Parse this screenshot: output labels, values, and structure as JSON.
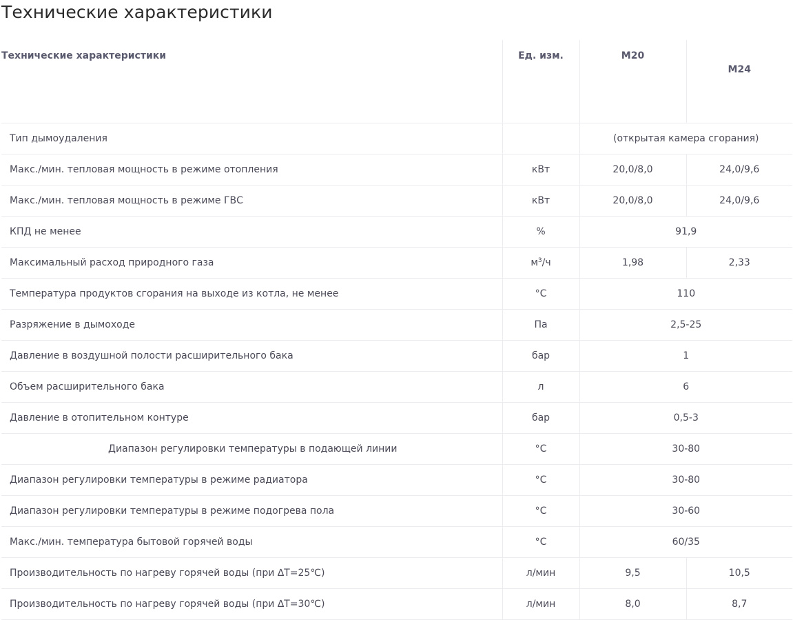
{
  "page": {
    "title": "Технические характеристики"
  },
  "table": {
    "headers": {
      "name": "Технические характеристики",
      "unit": "Ед. изм.",
      "m20": "M20",
      "m24": "M24"
    },
    "rows": [
      {
        "name": "Тип дымоудаления",
        "unit": "",
        "shared": "(открытая камера сгорания)"
      },
      {
        "name": "Макс./мин. тепловая мощность в режиме отопления",
        "unit": "кВт",
        "m20": "20,0/8,0",
        "m24": "24,0/9,6"
      },
      {
        "name": "Макс./мин. тепловая мощность в режиме ГВС",
        "unit": "кВт",
        "m20": "20,0/8,0",
        "m24": "24,0/9,6"
      },
      {
        "name": "КПД не менее",
        "unit": "%",
        "shared": "91,9"
      },
      {
        "name": "Максимальный  расход природного газа",
        "unit_base": "м",
        "unit_sup": "3",
        "unit_tail": "/ч",
        "m20": "1,98",
        "m24": "2,33"
      },
      {
        "name": "Температура продуктов сгорания на выходе из котла, не менее",
        "unit": "°С",
        "shared": "110"
      },
      {
        "name": "Разряжение в дымоходе",
        "unit": "Па",
        "shared": "2,5-25"
      },
      {
        "name": "Давление в воздушной полости расширительного бака",
        "unit": "бар",
        "shared": "1"
      },
      {
        "name": "Объем расширительного бака",
        "unit": "л",
        "shared": "6"
      },
      {
        "name": "Давление в отопительном контуре",
        "unit": "бар",
        "shared": "0,5-3"
      },
      {
        "name": "Диапазон регулировки температуры в подающей линии",
        "unit": "°С",
        "shared": "30-80"
      },
      {
        "name": "Диапазон регулировки температуры в режиме радиатора",
        "unit": "°С",
        "shared": "30-80"
      },
      {
        "name": "Диапазон регулировки температуры в режиме подогрева пола",
        "unit": "°С",
        "shared": "30-60"
      },
      {
        "name": "Макс./мин. температура бытовой горячей воды",
        "unit": "°С",
        "shared": "60/35"
      },
      {
        "name": "Производительность по нагреву горячей воды   (при ∆T=25℃)",
        "unit": "л/мин",
        "m20": "9,5",
        "m24": "10,5"
      },
      {
        "name": "Производительность по нагреву горячей воды  (при ∆T=30℃)",
        "unit": "л/мин",
        "m20": "8,0",
        "m24": "8,7"
      }
    ]
  }
}
